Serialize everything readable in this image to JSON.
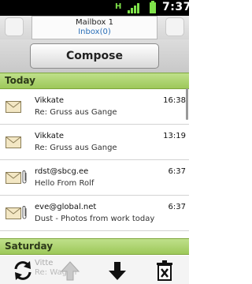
{
  "status_bar": {
    "network_label": "H",
    "time": "7:37",
    "icons": [
      "network-type-icon",
      "signal-icon",
      "battery-icon"
    ]
  },
  "header": {
    "mailbox_name": "Mailbox 1",
    "inbox_count": "Inbox(0)",
    "compose_label": "Compose"
  },
  "sections": [
    {
      "label": "Today"
    },
    {
      "label": "Saturday"
    }
  ],
  "messages": [
    {
      "from": "Vikkate",
      "subject": "Re: Gruss aus Gange",
      "time": "16:38",
      "attachment": false,
      "icon": "envelope-icon"
    },
    {
      "from": "Vikkate",
      "subject": "Re: Gruss aus Gange",
      "time": "13:19",
      "attachment": false,
      "icon": "envelope-icon"
    },
    {
      "from": "rdst@sbcg.ee",
      "subject": "Hello From Rolf",
      "time": "6:37",
      "attachment": true,
      "icon": "envelope-icon"
    },
    {
      "from": "eve@global.net",
      "subject": "Dust - Photos from work today",
      "time": "6:37",
      "attachment": true,
      "icon": "envelope-icon"
    }
  ],
  "partial_row": {
    "from": "Vitte",
    "subject": "Re: Wagan"
  },
  "toolbar": {
    "buttons": [
      "refresh-icon",
      "up-arrow-icon",
      "down-arrow-icon",
      "delete-icon"
    ]
  },
  "colors": {
    "section_green": "#a8cf68",
    "accent_blue": "#2a6fb8",
    "status_green": "#7fe24a"
  }
}
